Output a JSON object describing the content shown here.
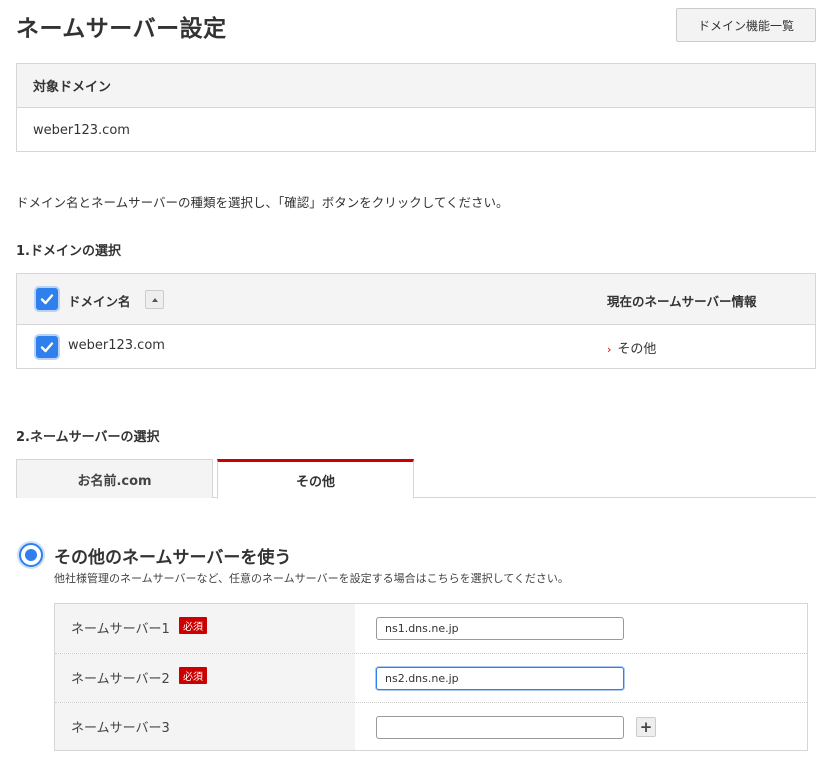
{
  "page": {
    "title": "ネームサーバー設定",
    "domain_functions_button": "ドメイン機能一覧"
  },
  "target_domain": {
    "header": "対象ドメイン",
    "value": "weber123.com"
  },
  "instructions": "ドメイン名とネームサーバーの種類を選択し、「確認」ボタンをクリックしてください。",
  "section1": {
    "title": "1.ドメインの選択",
    "table": {
      "col_domain": "ドメイン名",
      "col_current_ns": "現在のネームサーバー情報",
      "header_checked": true,
      "rows": [
        {
          "domain": "weber123.com",
          "current_ns": "その他",
          "checked": true
        }
      ]
    }
  },
  "section2": {
    "title": "2.ネームサーバーの選択",
    "tabs": [
      {
        "label": "お名前.com",
        "active": false
      },
      {
        "label": "その他",
        "active": true
      }
    ],
    "option": {
      "label": "その他のネームサーバーを使う",
      "description": "他社様管理のネームサーバーなど、任意のネームサーバーを設定する場合はこちらを選択してください。",
      "selected": true
    },
    "nameservers": [
      {
        "label": "ネームサーバー1",
        "required": "必須",
        "value": "ns1.dns.ne.jp"
      },
      {
        "label": "ネームサーバー2",
        "required": "必須",
        "value": "ns2.dns.ne.jp"
      },
      {
        "label": "ネームサーバー3",
        "required": "",
        "value": ""
      }
    ],
    "add_icon": "plus-icon"
  },
  "colors": {
    "accent_blue": "#2f80ed",
    "accent_red": "#cc0000",
    "header_bg": "#f4f4f4"
  }
}
